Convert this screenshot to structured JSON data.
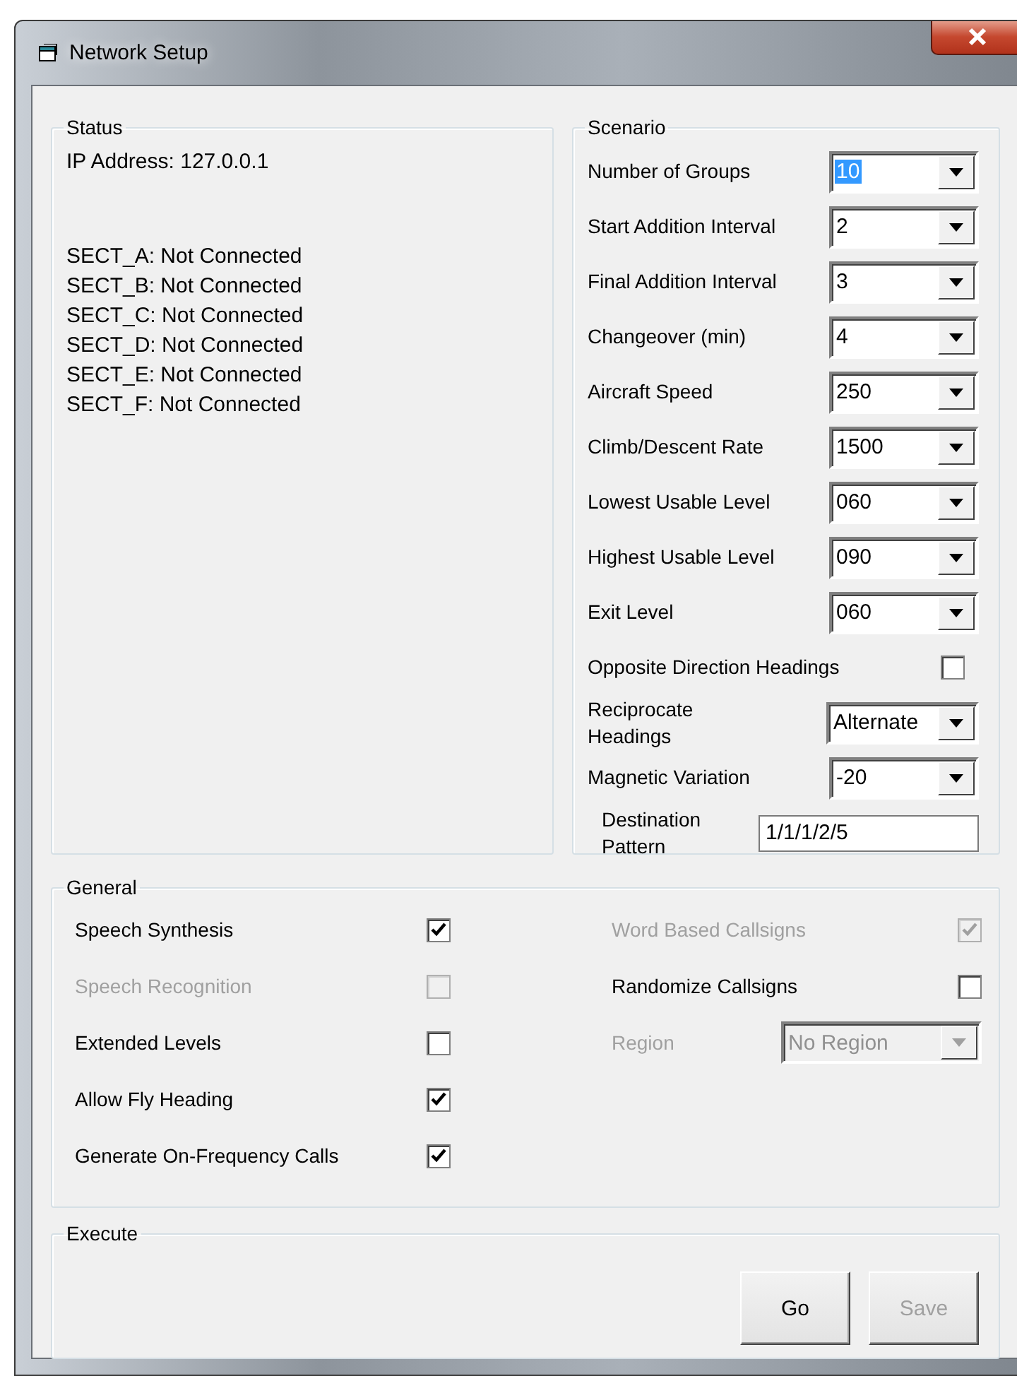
{
  "window": {
    "title": "Network Setup"
  },
  "status": {
    "title": "Status",
    "ip": "IP Address: 127.0.0.1",
    "sectors": [
      "SECT_A: Not Connected",
      "SECT_B: Not Connected",
      "SECT_C: Not Connected",
      "SECT_D: Not Connected",
      "SECT_E: Not Connected",
      "SECT_F: Not Connected"
    ]
  },
  "scenario": {
    "title": "Scenario",
    "fields": [
      {
        "kind": "combo",
        "label": "Number of Groups",
        "value": "10",
        "focused": true
      },
      {
        "kind": "combo",
        "label": "Start Addition Interval",
        "value": "2",
        "focused": false
      },
      {
        "kind": "combo",
        "label": "Final Addition Interval",
        "value": "3",
        "focused": false
      },
      {
        "kind": "combo",
        "label": "Changeover (min)",
        "value": "4",
        "focused": false
      },
      {
        "kind": "combo",
        "label": "Aircraft Speed",
        "value": "250",
        "focused": false
      },
      {
        "kind": "combo",
        "label": "Climb/Descent Rate",
        "value": "1500",
        "focused": false
      },
      {
        "kind": "combo",
        "label": "Lowest Usable Level",
        "value": "060",
        "focused": false
      },
      {
        "kind": "combo",
        "label": "Highest Usable Level",
        "value": "090",
        "focused": false
      },
      {
        "kind": "combo",
        "label": "Exit Level",
        "value": "060",
        "focused": false
      },
      {
        "kind": "checkbox",
        "label": "Opposite Direction Headings",
        "checked": false
      },
      {
        "kind": "combo",
        "label": "Reciprocate Headings",
        "value": "Alternate",
        "focused": false
      },
      {
        "kind": "combo",
        "label": "Magnetic Variation",
        "value": "-20",
        "focused": false
      },
      {
        "kind": "text",
        "label": "Destination Pattern",
        "value": "1/1/1/2/5"
      }
    ]
  },
  "general": {
    "title": "General",
    "left": [
      {
        "kind": "checkbox",
        "label": "Speech Synthesis",
        "checked": true,
        "disabled": false
      },
      {
        "kind": "checkbox",
        "label": "Speech Recognition",
        "checked": false,
        "disabled": true
      },
      {
        "kind": "checkbox",
        "label": "Extended Levels",
        "checked": false,
        "disabled": false
      },
      {
        "kind": "checkbox",
        "label": "Allow Fly Heading",
        "checked": true,
        "disabled": false
      },
      {
        "kind": "checkbox",
        "label": "Generate On-Frequency Calls",
        "checked": true,
        "disabled": false
      }
    ],
    "right": [
      {
        "kind": "checkbox",
        "label": "Word Based Callsigns",
        "checked": true,
        "disabled": true
      },
      {
        "kind": "checkbox",
        "label": "Randomize Callsigns",
        "checked": false,
        "disabled": false
      },
      {
        "kind": "combo",
        "label": "Region",
        "value": "No Region",
        "disabled": true
      }
    ]
  },
  "execute": {
    "title": "Execute",
    "buttons": [
      {
        "label": "Go",
        "disabled": false
      },
      {
        "label": "Save",
        "disabled": true
      }
    ]
  }
}
